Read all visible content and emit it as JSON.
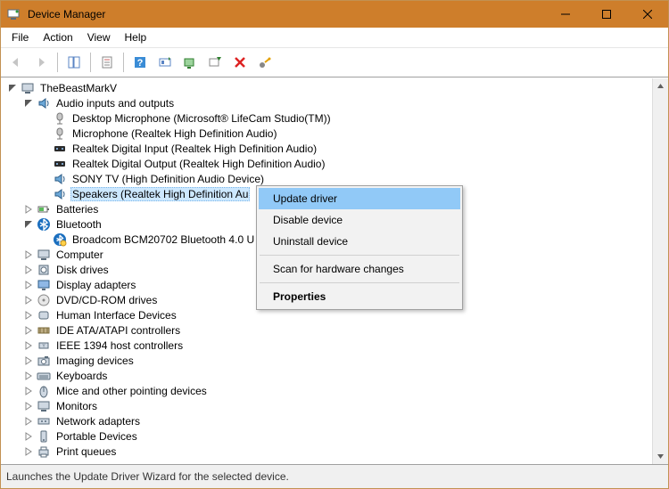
{
  "window": {
    "title": "Device Manager"
  },
  "menubar": [
    "File",
    "Action",
    "View",
    "Help"
  ],
  "statusbar": "Launches the Update Driver Wizard for the selected device.",
  "context_menu": {
    "items": [
      {
        "label": "Update driver",
        "highlighted": true
      },
      {
        "label": "Disable device"
      },
      {
        "label": "Uninstall device"
      },
      {
        "sep": true
      },
      {
        "label": "Scan for hardware changes"
      },
      {
        "sep": true
      },
      {
        "label": "Properties",
        "bold": true
      }
    ]
  },
  "tree": {
    "root": {
      "label": "TheBeastMarkV",
      "icon": "computer-icon",
      "expanded": true,
      "children": [
        {
          "label": "Audio inputs and outputs",
          "icon": "speaker-icon",
          "expanded": true,
          "children": [
            {
              "label": "Desktop Microphone (Microsoft® LifeCam Studio(TM))",
              "icon": "mic-icon"
            },
            {
              "label": "Microphone (Realtek High Definition Audio)",
              "icon": "mic-icon"
            },
            {
              "label": "Realtek Digital Input (Realtek High Definition Audio)",
              "icon": "digital-audio-icon"
            },
            {
              "label": "Realtek Digital Output (Realtek High Definition Audio)",
              "icon": "digital-audio-icon"
            },
            {
              "label": "SONY TV (High Definition Audio Device)",
              "icon": "speaker-icon"
            },
            {
              "label": "Speakers (Realtek High Definition Au",
              "icon": "speaker-icon",
              "selected": true
            }
          ]
        },
        {
          "label": "Batteries",
          "icon": "battery-icon",
          "expanded": false,
          "children": true
        },
        {
          "label": "Bluetooth",
          "icon": "bluetooth-icon",
          "expanded": true,
          "children": [
            {
              "label": "Broadcom BCM20702 Bluetooth 4.0 U",
              "icon": "bluetooth-adapter-icon"
            }
          ]
        },
        {
          "label": "Computer",
          "icon": "computer-icon",
          "expanded": false,
          "children": true
        },
        {
          "label": "Disk drives",
          "icon": "disk-icon",
          "expanded": false,
          "children": true
        },
        {
          "label": "Display adapters",
          "icon": "display-icon",
          "expanded": false,
          "children": true
        },
        {
          "label": "DVD/CD-ROM drives",
          "icon": "optical-icon",
          "expanded": false,
          "children": true
        },
        {
          "label": "Human Interface Devices",
          "icon": "hid-icon",
          "expanded": false,
          "children": true
        },
        {
          "label": "IDE ATA/ATAPI controllers",
          "icon": "ide-icon",
          "expanded": false,
          "children": true
        },
        {
          "label": "IEEE 1394 host controllers",
          "icon": "firewire-icon",
          "expanded": false,
          "children": true
        },
        {
          "label": "Imaging devices",
          "icon": "camera-icon",
          "expanded": false,
          "children": true
        },
        {
          "label": "Keyboards",
          "icon": "keyboard-icon",
          "expanded": false,
          "children": true
        },
        {
          "label": "Mice and other pointing devices",
          "icon": "mouse-icon",
          "expanded": false,
          "children": true
        },
        {
          "label": "Monitors",
          "icon": "monitors-icon",
          "expanded": false,
          "children": true
        },
        {
          "label": "Network adapters",
          "icon": "network-icon",
          "expanded": false,
          "children": true
        },
        {
          "label": "Portable Devices",
          "icon": "portable-icon",
          "expanded": false,
          "children": true
        },
        {
          "label": "Print queues",
          "icon": "printer-icon",
          "expanded": false,
          "children": true
        }
      ]
    }
  }
}
